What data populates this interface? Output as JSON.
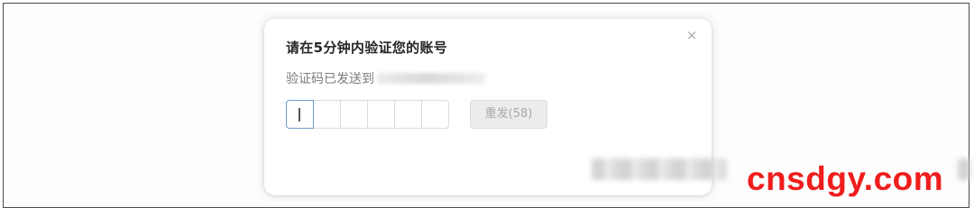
{
  "dialog": {
    "title": "请在5分钟内验证您的账号",
    "close_icon": "×",
    "sent_to_label": "验证码已发送到",
    "code_cells": [
      "",
      "",
      "",
      "",
      "",
      ""
    ],
    "resend_label": "重发(58)"
  },
  "watermark": {
    "text": "cnsdgy.com",
    "color": "#ef1d1d"
  },
  "colors": {
    "active_cell_border": "#6b9bc9",
    "disabled_button_bg": "#ececec"
  }
}
